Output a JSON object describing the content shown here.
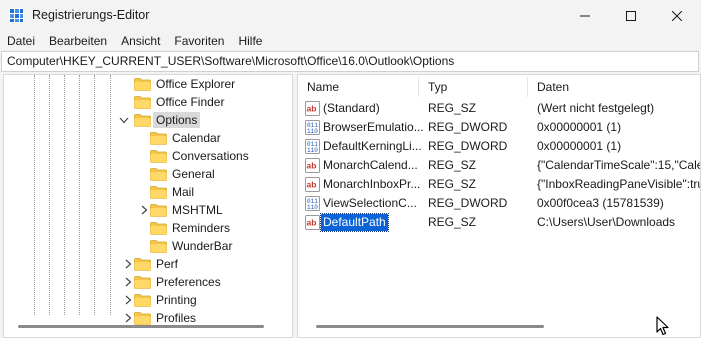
{
  "window": {
    "title": "Registrierungs-Editor",
    "minimize_icon": "minimize-icon",
    "maximize_icon": "maximize-icon",
    "close_icon": "close-icon"
  },
  "menu": [
    "Datei",
    "Bearbeiten",
    "Ansicht",
    "Favoriten",
    "Hilfe"
  ],
  "address": "Computer\\HKEY_CURRENT_USER\\Software\\Microsoft\\Office\\16.0\\Outlook\\Options",
  "tree": {
    "items": [
      {
        "label": "Office Explorer",
        "expander": "none",
        "selected": false
      },
      {
        "label": "Office Finder",
        "expander": "none",
        "selected": false
      },
      {
        "label": "Options",
        "expander": "expanded",
        "selected": true
      },
      {
        "label": "Calendar",
        "expander": "none",
        "selected": false
      },
      {
        "label": "Conversations",
        "expander": "none",
        "selected": false
      },
      {
        "label": "General",
        "expander": "none",
        "selected": false
      },
      {
        "label": "Mail",
        "expander": "none",
        "selected": false
      },
      {
        "label": "MSHTML",
        "expander": "collapsed",
        "selected": false
      },
      {
        "label": "Reminders",
        "expander": "none",
        "selected": false
      },
      {
        "label": "WunderBar",
        "expander": "none",
        "selected": false
      },
      {
        "label": "Perf",
        "expander": "collapsed",
        "selected": false
      },
      {
        "label": "Preferences",
        "expander": "collapsed",
        "selected": false
      },
      {
        "label": "Printing",
        "expander": "collapsed",
        "selected": false
      },
      {
        "label": "Profiles",
        "expander": "collapsed",
        "selected": false
      }
    ]
  },
  "list": {
    "columns": {
      "name": "Name",
      "type": "Typ",
      "data": "Daten"
    },
    "rows": [
      {
        "name": "(Standard)",
        "type": "REG_SZ",
        "data": "(Wert nicht festgelegt)",
        "icon": "string-value-icon",
        "selected": false
      },
      {
        "name": "BrowserEmulatio...",
        "type": "REG_DWORD",
        "data": "0x00000001 (1)",
        "icon": "binary-value-icon",
        "selected": false
      },
      {
        "name": "DefaultKerningLi...",
        "type": "REG_DWORD",
        "data": "0x00000001 (1)",
        "icon": "binary-value-icon",
        "selected": false
      },
      {
        "name": "MonarchCalend...",
        "type": "REG_SZ",
        "data": "{\"CalendarTimeScale\":15,\"Calen",
        "icon": "string-value-icon",
        "selected": false
      },
      {
        "name": "MonarchInboxPr...",
        "type": "REG_SZ",
        "data": "{\"InboxReadingPaneVisible\":tru",
        "icon": "string-value-icon",
        "selected": false
      },
      {
        "name": "ViewSelectionC...",
        "type": "REG_DWORD",
        "data": "0x00f0cea3 (15781539)",
        "icon": "binary-value-icon",
        "selected": false
      },
      {
        "name": "DefaultPath",
        "type": "REG_SZ",
        "data": "C:\\Users\\User\\Downloads",
        "icon": "string-value-icon",
        "selected": true
      }
    ]
  }
}
